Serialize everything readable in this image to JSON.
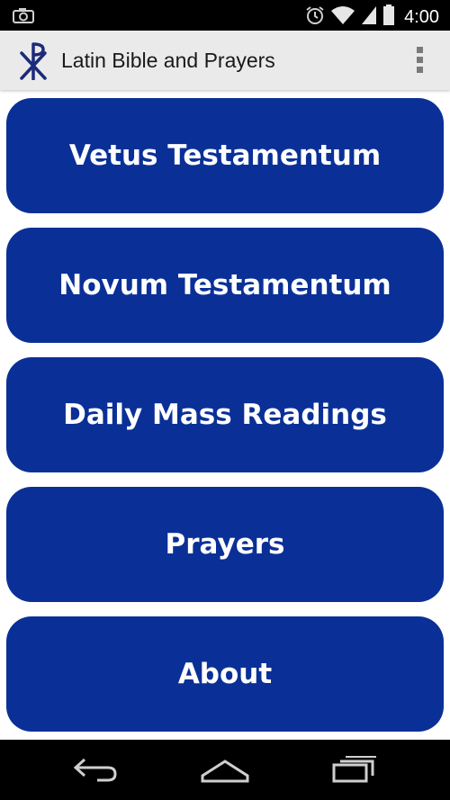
{
  "status_bar": {
    "time": "4:00",
    "icons": [
      "camera-icon",
      "alarm-icon",
      "wifi-icon",
      "signal-icon",
      "battery-icon"
    ]
  },
  "app_bar": {
    "title": "Latin Bible and Prayers",
    "logo": "chi-rho-icon",
    "overflow": "overflow-menu-icon"
  },
  "menu": {
    "items": [
      {
        "label": "Vetus Testamentum"
      },
      {
        "label": "Novum Testamentum"
      },
      {
        "label": "Daily Mass Readings"
      },
      {
        "label": "Prayers"
      },
      {
        "label": "About"
      }
    ]
  },
  "nav_bar": {
    "icons": [
      "back-icon",
      "home-icon",
      "recents-icon"
    ]
  },
  "colors": {
    "button": "#0a3097",
    "action_bar": "#eaeaea",
    "logo": "#1d2a7a"
  }
}
